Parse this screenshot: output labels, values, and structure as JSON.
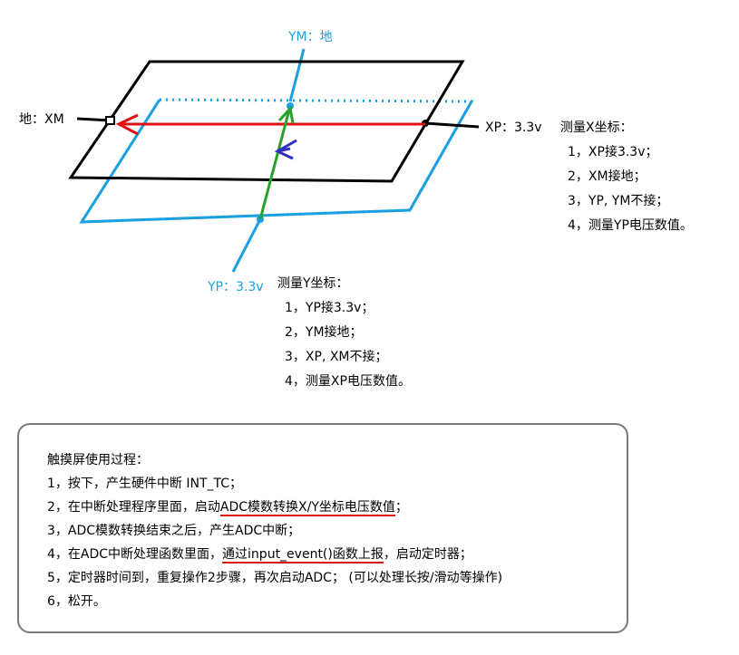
{
  "labels": {
    "top": "YM：地",
    "left": "地：XM",
    "right": "XP：3.3v",
    "bottom": "YP：3.3v"
  },
  "measure_x": {
    "title": "测量X坐标：",
    "steps": [
      "1，XP接3.3v；",
      "2，XM接地；",
      "3，YP, YM不接；",
      "4，测量YP电压数值。"
    ]
  },
  "measure_y": {
    "title": "测量Y坐标：",
    "steps": [
      "1，YP接3.3v；",
      "2，YM接地；",
      "3，XP, XM不接；",
      "4，测量XP电压数值。"
    ]
  },
  "process": {
    "title": "触摸屏使用过程：",
    "step1": "1，按下，产生硬件中断 INT_TC；",
    "step2_pre": "2，在中断处理程序里面，启动",
    "step2_ul": "ADC模数转换X/Y坐标电压数值",
    "step2_post": "；",
    "step3": "3，ADC模数转换结束之后，产生ADC中断；",
    "step4_pre": "4，在ADC中断处理函数里面，",
    "step4_ul": "通过input_event()函数上报",
    "step4_post": "，启动定时器；",
    "step5": "5，定时器时间到，重复操作2步骤，再次启动ADC；   (可以处理长按/滑动等操作)",
    "step6": "6，松开。"
  },
  "colors": {
    "black_plate": "#000000",
    "blue_plate": "#1aa0e0",
    "x_arrow": "#e01010",
    "y_arrow": "#2aa02a",
    "small_arrow": "#3030c0",
    "underline": "#e01010",
    "box_border": "#7a7a7a"
  }
}
